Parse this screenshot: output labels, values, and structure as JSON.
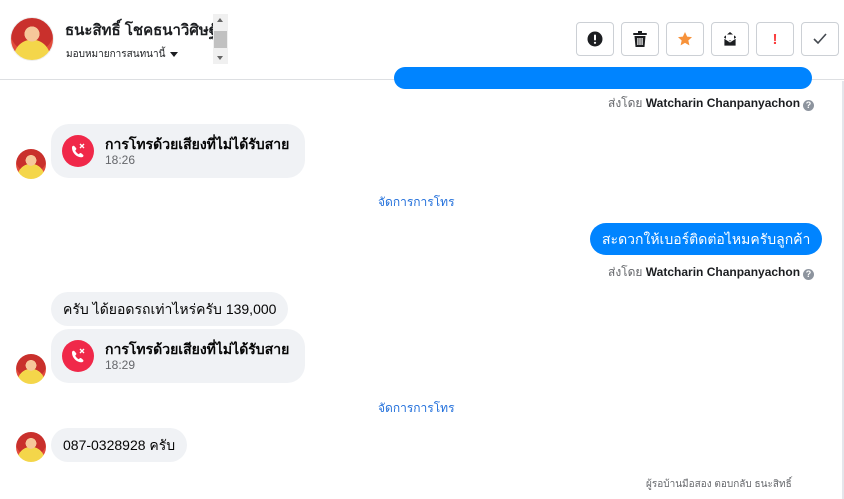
{
  "header": {
    "contact_name": "ธนะสิทธิ์ โชคธนาวิศิษฐ์",
    "assign_label": "มอบหมายการสนทนานี้",
    "toolbar": [
      {
        "name": "spam-button",
        "icon": "exclamation-circle-icon"
      },
      {
        "name": "delete-button",
        "icon": "trash-icon"
      },
      {
        "name": "star-button",
        "icon": "star-icon"
      },
      {
        "name": "mark-unread-button",
        "icon": "envelope-icon"
      },
      {
        "name": "follow-up-button",
        "icon": "exclamation-icon",
        "label": "!"
      },
      {
        "name": "done-button",
        "icon": "checkmark-icon"
      }
    ]
  },
  "messages": {
    "sent_by_1": {
      "prefix": "ส่งโดย",
      "name": "Watcharin Chanpanyachon"
    },
    "call_1": {
      "title": "การโทรด้วยเสียงที่ไม่ได้รับสาย",
      "time": "18:26"
    },
    "manage_1": "จัดการการโทร",
    "outgoing_1": "สะดวกให้เบอร์ติดต่อไหมครับลูกค้า",
    "sent_by_2": {
      "prefix": "ส่งโดย",
      "name": "Watcharin Chanpanyachon"
    },
    "incoming_1": "ครับ  ได้ยอดรถเท่าไหร่ครับ 139,000",
    "call_2": {
      "title": "การโทรด้วยเสียงที่ไม่ได้รับสาย",
      "time": "18:29"
    },
    "manage_2": "จัดการการโทร",
    "incoming_2": "087-0328928 ครับ",
    "footer": "ผู้รอบ้านมือสอง ตอบกลับ ธนะสิทธิ์"
  },
  "colors": {
    "accent": "#0084ff",
    "missed_call": "#f02849",
    "star": "#f7923a",
    "follow_up": "#fa3e3e",
    "link": "#216fdb"
  }
}
